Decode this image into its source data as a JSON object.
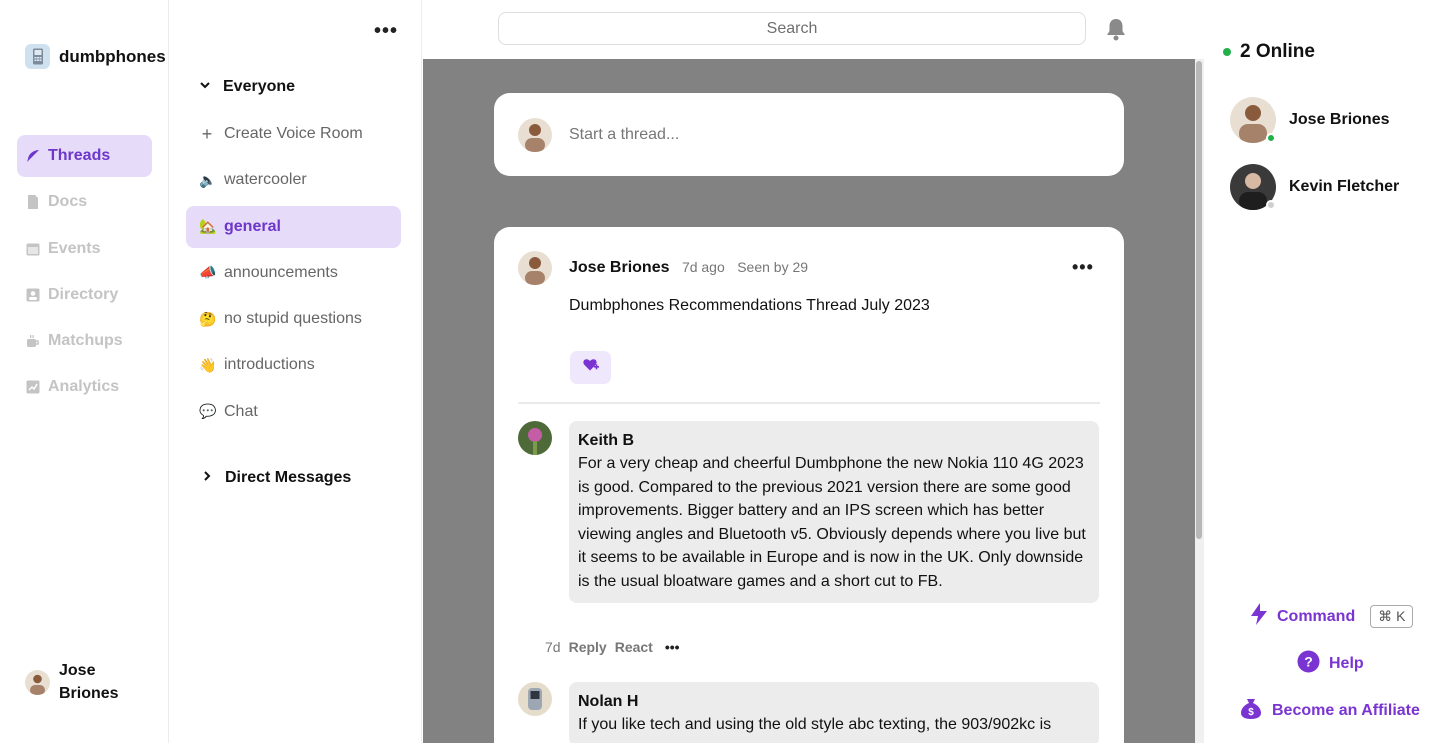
{
  "brand": {
    "name": "dumbphones"
  },
  "nav": {
    "items": [
      {
        "label": "Threads",
        "icon": "feather-icon",
        "active": true
      },
      {
        "label": "Docs",
        "icon": "doc-icon"
      },
      {
        "label": "Events",
        "icon": "calendar-icon"
      },
      {
        "label": "Directory",
        "icon": "directory-icon"
      },
      {
        "label": "Matchups",
        "icon": "coffee-icon"
      },
      {
        "label": "Analytics",
        "icon": "chart-icon"
      }
    ]
  },
  "current_user": {
    "name": "Jose Briones"
  },
  "channels": {
    "more": "•••",
    "group_label": "Everyone",
    "items": [
      {
        "label": "Create Voice Room",
        "icon": "+"
      },
      {
        "label": "watercooler",
        "icon": "🔈"
      },
      {
        "label": "general",
        "icon": "🏡",
        "active": true
      },
      {
        "label": "announcements",
        "icon": "📣"
      },
      {
        "label": "no stupid questions",
        "icon": "🤔"
      },
      {
        "label": "introductions",
        "icon": "👋"
      },
      {
        "label": "Chat",
        "icon": "💬"
      }
    ],
    "dm_label": "Direct Messages"
  },
  "topbar": {
    "search_placeholder": "Search"
  },
  "composer": {
    "placeholder": "Start a thread..."
  },
  "thread": {
    "author": "Jose Briones",
    "age": "7d ago",
    "seen": "Seen by 29",
    "more": "•••",
    "title": "Dumbphones Recommendations Thread July 2023",
    "comments": [
      {
        "author": "Keith B",
        "text": "For a very cheap and cheerful Dumbphone the new Nokia 110 4G 2023 is good. Compared to the previous 2021 version there are some good improvements. Bigger battery and an IPS screen which has better viewing angles and Bluetooth v5. Obviously depends where you live but it seems to be available in Europe and is now in the UK. Only downside is the usual bloatware games and a short cut to FB.",
        "age": "7d",
        "reply": "Reply",
        "react": "React",
        "more": "•••"
      },
      {
        "author": "Nolan H",
        "text": "If you like tech and using the old style abc texting, the 903/902kc is"
      }
    ]
  },
  "online": {
    "label": "2 Online",
    "members": [
      {
        "name": "Jose Briones",
        "status_color": "#22b04b"
      },
      {
        "name": "Kevin Fletcher",
        "status_color": "#cfcfcf"
      }
    ]
  },
  "footer": {
    "command": "Command",
    "command_kbd": "⌘ K",
    "help": "Help",
    "affiliate": "Become an Affiliate"
  },
  "colors": {
    "accent": "#6d37c9",
    "active_bg": "#e6dcfa",
    "main_bg": "#828282"
  }
}
